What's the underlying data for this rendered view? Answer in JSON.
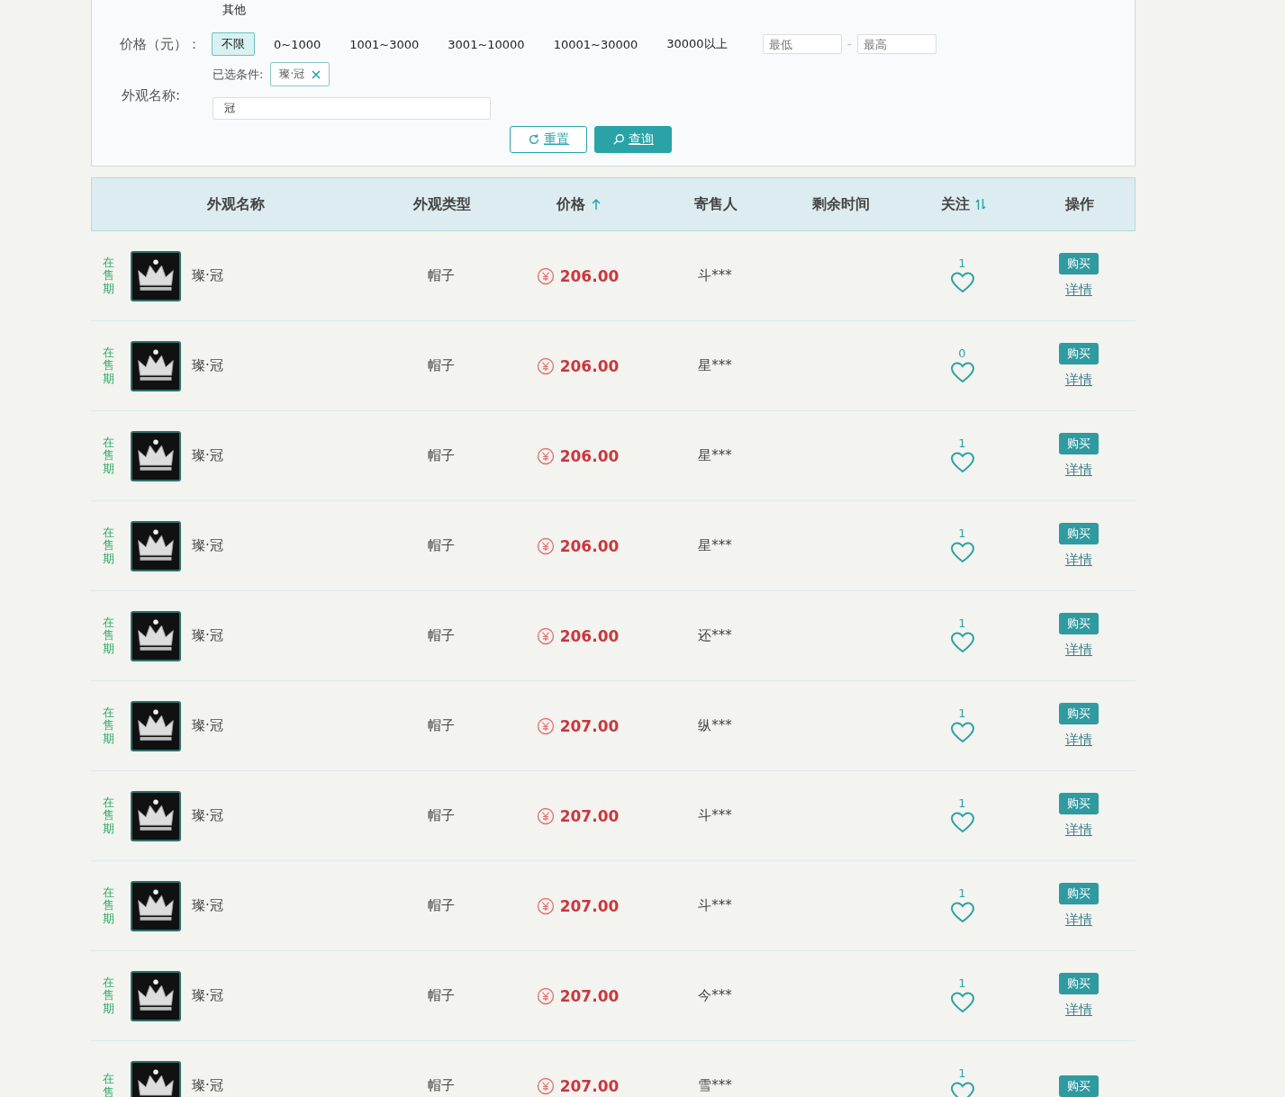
{
  "type_filter": {
    "options": [
      {
        "label": "其他",
        "selected": false
      }
    ]
  },
  "price_filter": {
    "label": "价格（元）：",
    "options": [
      {
        "label": "不限",
        "selected": true
      },
      {
        "label": "0~1000",
        "selected": false
      },
      {
        "label": "1001~3000",
        "selected": false
      },
      {
        "label": "3001~10000",
        "selected": false
      },
      {
        "label": "10001~30000",
        "selected": false
      },
      {
        "label": "30000以上",
        "selected": false
      }
    ],
    "min_placeholder": "最低",
    "separator": "-",
    "max_placeholder": "最高"
  },
  "selected_conditions": {
    "label": "已选条件:",
    "tags": [
      "璨·冠"
    ]
  },
  "name_filter": {
    "label": "外观名称:",
    "value": "冠"
  },
  "buttons": [
    {
      "kind": "reset",
      "label": "重置"
    },
    {
      "kind": "search",
      "label": "查询"
    }
  ],
  "table": {
    "columns": [
      {
        "label": "外观名称",
        "kind": "plain"
      },
      {
        "label": "外观类型",
        "kind": "plain"
      },
      {
        "label": "价格",
        "kind": "sort_asc"
      },
      {
        "label": "寄售人",
        "kind": "plain"
      },
      {
        "label": "剩余时间",
        "kind": "plain"
      },
      {
        "label": "关注",
        "kind": "sort_both"
      },
      {
        "label": "操作",
        "kind": "plain"
      }
    ],
    "rows": [
      {
        "status": "在售期",
        "name": "璨·冠",
        "type": "帽子",
        "price": "206.00",
        "seller": "斗***",
        "follows": "1",
        "buy": "购买",
        "detail": "详情"
      },
      {
        "status": "在售期",
        "name": "璨·冠",
        "type": "帽子",
        "price": "206.00",
        "seller": "星***",
        "follows": "0",
        "buy": "购买",
        "detail": "详情"
      },
      {
        "status": "在售期",
        "name": "璨·冠",
        "type": "帽子",
        "price": "206.00",
        "seller": "星***",
        "follows": "1",
        "buy": "购买",
        "detail": "详情"
      },
      {
        "status": "在售期",
        "name": "璨·冠",
        "type": "帽子",
        "price": "206.00",
        "seller": "星***",
        "follows": "1",
        "buy": "购买",
        "detail": "详情"
      },
      {
        "status": "在售期",
        "name": "璨·冠",
        "type": "帽子",
        "price": "206.00",
        "seller": "还***",
        "follows": "1",
        "buy": "购买",
        "detail": "详情"
      },
      {
        "status": "在售期",
        "name": "璨·冠",
        "type": "帽子",
        "price": "207.00",
        "seller": "纵***",
        "follows": "1",
        "buy": "购买",
        "detail": "详情"
      },
      {
        "status": "在售期",
        "name": "璨·冠",
        "type": "帽子",
        "price": "207.00",
        "seller": "斗***",
        "follows": "1",
        "buy": "购买",
        "detail": "详情"
      },
      {
        "status": "在售期",
        "name": "璨·冠",
        "type": "帽子",
        "price": "207.00",
        "seller": "斗***",
        "follows": "1",
        "buy": "购买",
        "detail": "详情"
      },
      {
        "status": "在售期",
        "name": "璨·冠",
        "type": "帽子",
        "price": "207.00",
        "seller": "今***",
        "follows": "1",
        "buy": "购买",
        "detail": "详情"
      },
      {
        "status": "在售",
        "name": "璨·冠",
        "type": "帽子",
        "price": "207.00",
        "seller": "雪***",
        "follows": "1",
        "buy": "购买"
      }
    ]
  }
}
